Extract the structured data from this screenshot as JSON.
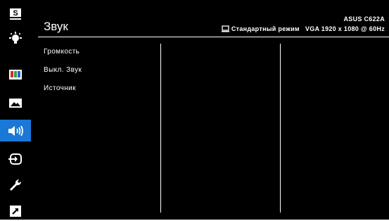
{
  "header": {
    "title": "Звук",
    "model": "ASUS C622A",
    "mode": "Стандартный режим",
    "signal": "VGA 1920 x 1080 @ 60Hz"
  },
  "sidebar": {
    "items": [
      {
        "name": "splendid",
        "icon": "s-badge-icon",
        "label": "S"
      },
      {
        "name": "blue-light",
        "icon": "bulb-icon"
      },
      {
        "name": "color",
        "icon": "color-bars-icon"
      },
      {
        "name": "image",
        "icon": "picture-icon"
      },
      {
        "name": "sound",
        "icon": "speaker-icon",
        "active": true
      },
      {
        "name": "input",
        "icon": "input-icon"
      },
      {
        "name": "system-setup",
        "icon": "wrench-icon"
      },
      {
        "name": "shortcut",
        "icon": "shortcut-arrow-icon"
      }
    ]
  },
  "menu": {
    "items": [
      {
        "label": "Громкость"
      },
      {
        "label": "Выкл. Звук"
      },
      {
        "label": "Источник"
      }
    ]
  },
  "colors": {
    "background": "#000000",
    "accent": "#1a78d6",
    "text": "#ffffff"
  }
}
